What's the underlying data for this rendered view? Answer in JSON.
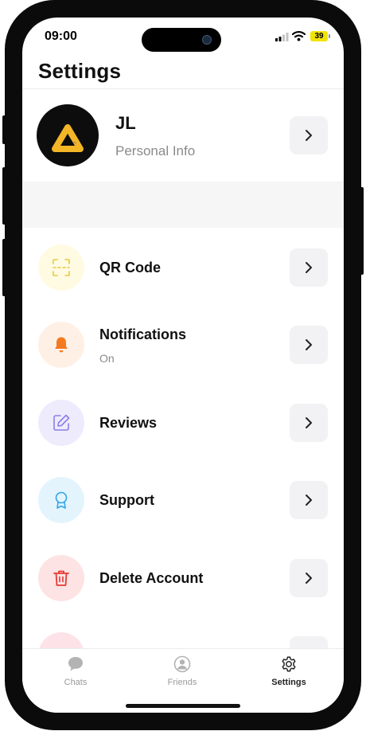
{
  "status_bar": {
    "time": "09:00",
    "battery": "39"
  },
  "header": {
    "title": "Settings"
  },
  "profile": {
    "name": "JL",
    "subtitle": "Personal Info"
  },
  "settings_items": [
    {
      "label": "QR Code",
      "icon": "qr-code-icon",
      "icon_color": "#e5c93a",
      "bg_color": "#fffbe3"
    },
    {
      "label": "Notifications",
      "sublabel": "On",
      "icon": "bell-icon",
      "icon_color": "#f47a20",
      "bg_color": "#fff0e6"
    },
    {
      "label": "Reviews",
      "icon": "edit-icon",
      "icon_color": "#8b7ee8",
      "bg_color": "#eeebfd"
    },
    {
      "label": "Support",
      "icon": "award-icon",
      "icon_color": "#2fa6e6",
      "bg_color": "#e3f4fd"
    },
    {
      "label": "Delete Account",
      "icon": "trash-icon",
      "icon_color": "#e53935",
      "bg_color": "#fde3e3"
    },
    {
      "label": "",
      "icon": "logout-icon",
      "icon_color": "#e53935",
      "bg_color": "#fde3e8"
    }
  ],
  "tabs": [
    {
      "label": "Chats",
      "icon": "chat-bubble-icon",
      "active": false
    },
    {
      "label": "Friends",
      "icon": "friends-icon",
      "active": false
    },
    {
      "label": "Settings",
      "icon": "gear-icon",
      "active": true
    }
  ]
}
